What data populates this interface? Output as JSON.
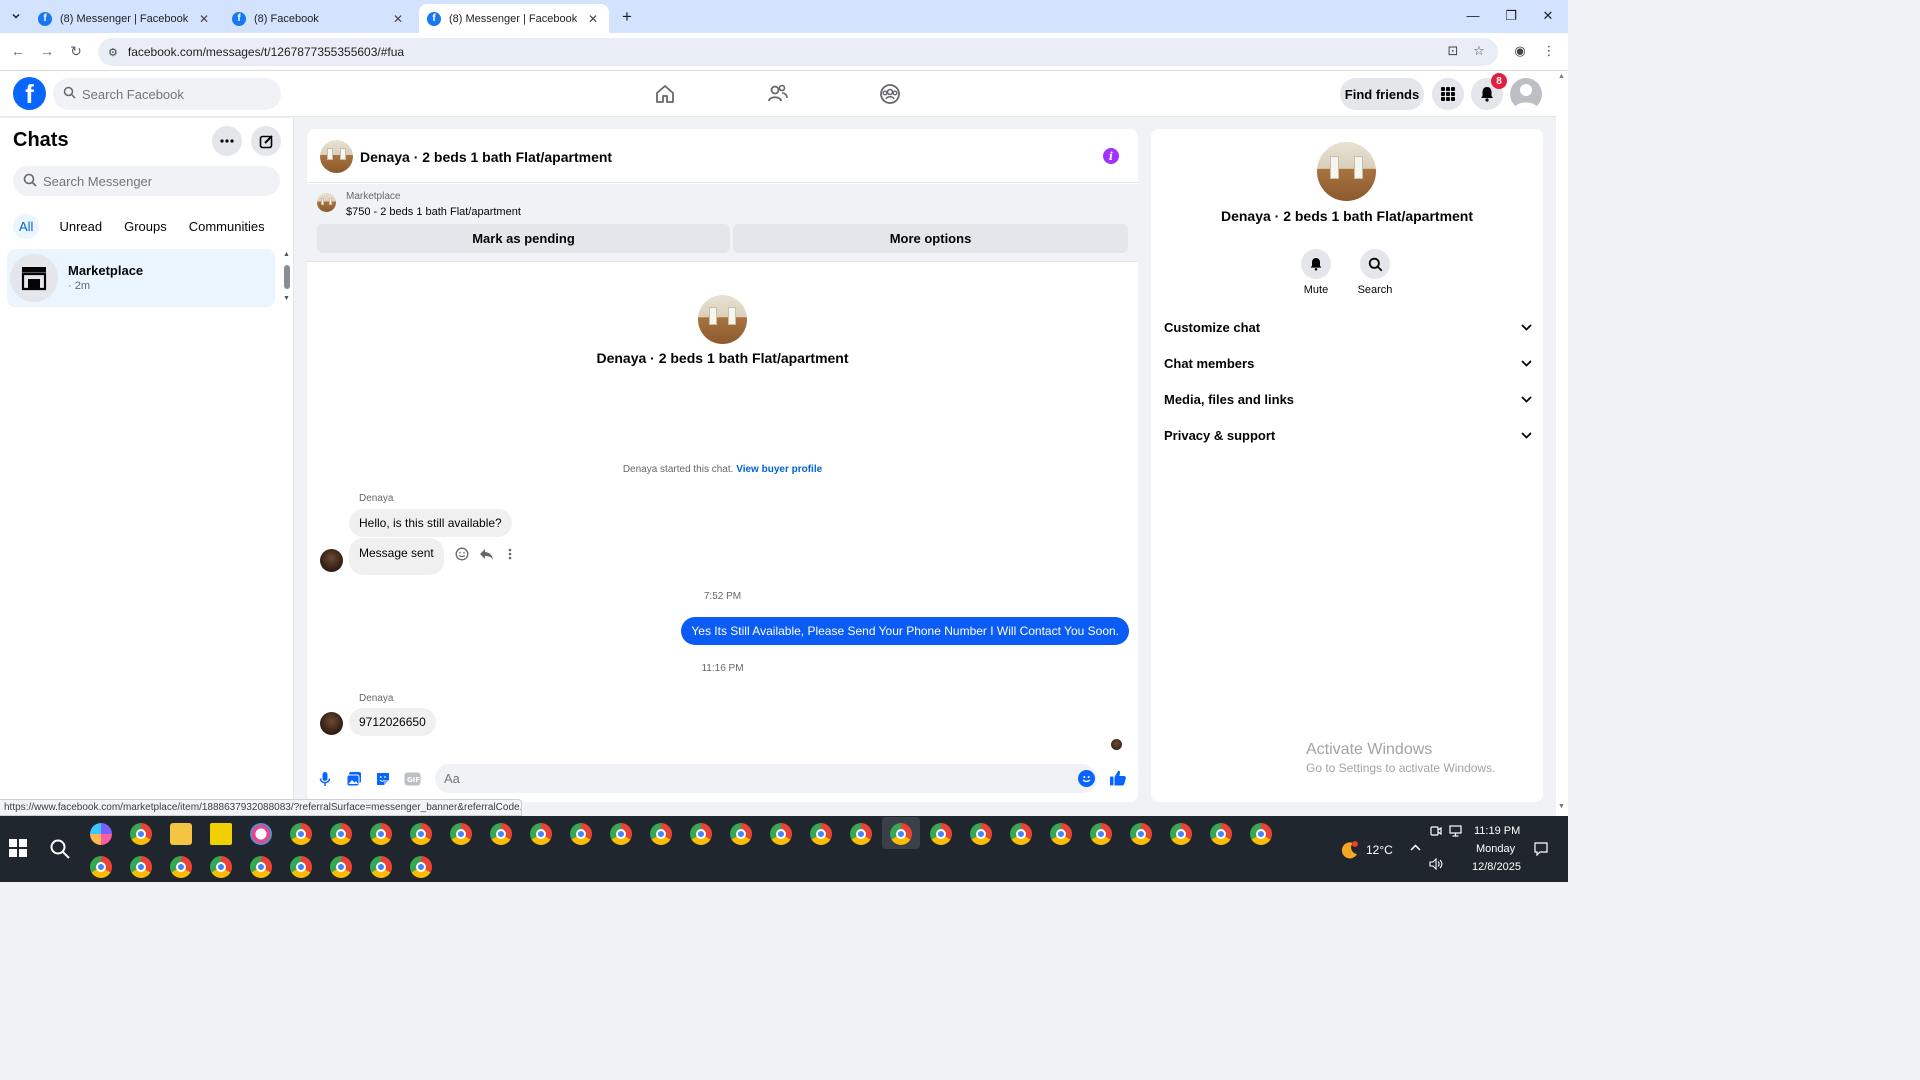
{
  "browser": {
    "tabs": [
      {
        "label": "(8) Messenger | Facebook"
      },
      {
        "label": "(8) Facebook"
      },
      {
        "label": "(8) Messenger | Facebook"
      }
    ],
    "url": "facebook.com/messages/t/1267877355355603/#fua"
  },
  "fb_nav": {
    "search_placeholder": "Search Facebook",
    "find_friends": "Find friends",
    "notifications_count": "8"
  },
  "chats": {
    "title": "Chats",
    "search_placeholder": "Search Messenger",
    "filters": [
      "All",
      "Unread",
      "Groups",
      "Communities"
    ],
    "items": [
      {
        "name": "Marketplace",
        "time": "· 2m"
      }
    ]
  },
  "conversation": {
    "title": "Denaya · 2 beds 1 bath Flat/apartment",
    "marketplace_label": "Marketplace",
    "listing": "$750 - 2 beds 1 bath Flat/apartment",
    "mark_pending": "Mark as pending",
    "more_options": "More options",
    "intro_name": "Denaya · 2 beds 1 bath Flat/apartment",
    "started_text": "Denaya started this chat.",
    "view_buyer": "View buyer profile",
    "messages": {
      "sender1": "Denaya",
      "msg1": "Hello, is this still available?",
      "msg2": "Message sent",
      "time1": "7:52 PM",
      "outgoing": "Yes Its Still Available, Please Send Your Phone Number I Will Contact You Soon.",
      "time2": "11:16 PM",
      "sender2": "Denaya",
      "msg3": "9712026650"
    },
    "composer_placeholder": "Aa"
  },
  "details": {
    "name": "Denaya · 2 beds 1 bath Flat/apartment",
    "actions": [
      {
        "label": "Mute"
      },
      {
        "label": "Search"
      }
    ],
    "sections": [
      "Customize chat",
      "Chat members",
      "Media, files and links",
      "Privacy & support"
    ]
  },
  "watermark": {
    "line1": "Activate Windows",
    "line2": "Go to Settings to activate Windows."
  },
  "status_url": "https://www.facebook.com/marketplace/item/1888637932088083/?referralSurface=messenger_banner&referralCode...",
  "taskbar": {
    "temperature": "12°C",
    "time": "11:19 PM",
    "day": "Monday",
    "date": "12/8/2025"
  },
  "colors": {
    "fb_blue": "#0866ff",
    "outgoing_bubble": "#0a5cf5",
    "info_purple": "#a033ff",
    "badge_red": "#e41e3f"
  }
}
